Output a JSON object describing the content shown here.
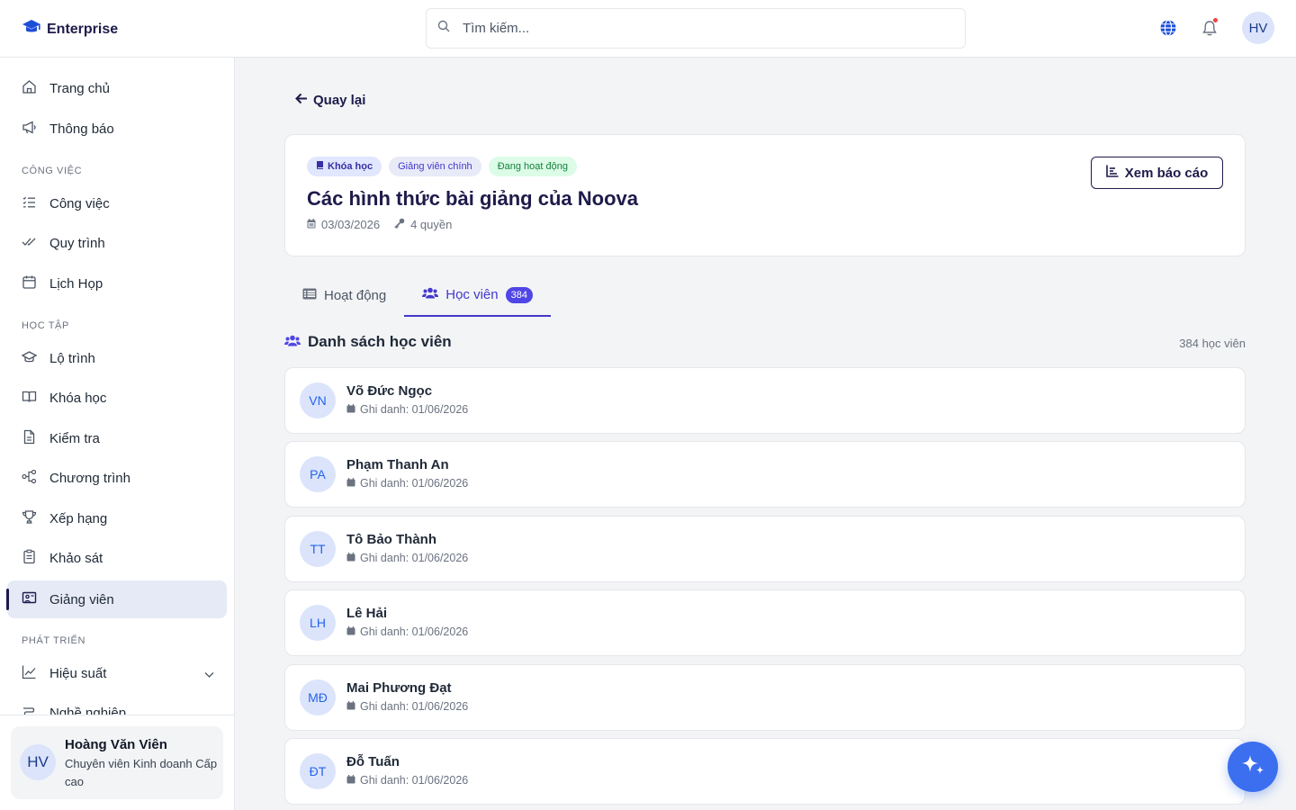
{
  "brand": {
    "name": "Enterprise"
  },
  "search": {
    "placeholder": "Tìm kiếm..."
  },
  "header": {
    "avatar_initials": "HV"
  },
  "sidebar": {
    "items_top": [
      {
        "label": "Trang chủ",
        "icon": "home-icon"
      },
      {
        "label": "Thông báo",
        "icon": "megaphone-icon"
      }
    ],
    "sections": [
      {
        "label": "CÔNG VIỆC",
        "items": [
          {
            "label": "Công việc",
            "icon": "task-list-icon"
          },
          {
            "label": "Quy trình",
            "icon": "double-check-icon"
          },
          {
            "label": "Lịch Họp",
            "icon": "calendar-icon"
          }
        ]
      },
      {
        "label": "HỌC TẬP",
        "items": [
          {
            "label": "Lộ trình",
            "icon": "graduation-cap-icon"
          },
          {
            "label": "Khóa học",
            "icon": "book-open-icon"
          },
          {
            "label": "Kiểm tra",
            "icon": "document-icon"
          },
          {
            "label": "Chương trình",
            "icon": "workflow-icon"
          },
          {
            "label": "Xếp hạng",
            "icon": "trophy-icon"
          },
          {
            "label": "Khảo sát",
            "icon": "clipboard-icon"
          },
          {
            "label": "Giảng viên",
            "icon": "presentation-icon",
            "active": true
          }
        ]
      },
      {
        "label": "PHÁT TRIỂN",
        "items": [
          {
            "label": "Hiệu suất",
            "icon": "line-chart-icon"
          },
          {
            "label": "Nghề nghiệp",
            "icon": "career-icon"
          }
        ]
      }
    ],
    "user": {
      "initials": "HV",
      "name": "Hoàng Văn Viên",
      "role": "Chuyên viên Kinh doanh Cấp cao"
    }
  },
  "main": {
    "back_label": "Quay lại",
    "course": {
      "tags": [
        "Khóa học",
        "Giảng viên chính",
        "Đang hoạt động"
      ],
      "title": "Các hình thức bài giảng của Noova",
      "date": "03/03/2026",
      "permissions": "4 quyền",
      "report_button": "Xem báo cáo"
    },
    "tabs": [
      {
        "label": "Hoạt động",
        "icon": "list-icon"
      },
      {
        "label": "Học viên",
        "icon": "users-icon",
        "count": "384",
        "active": true
      }
    ],
    "list": {
      "title": "Danh sách học viên",
      "count_text": "384 học viên",
      "students": [
        {
          "initials": "VN",
          "name": "Võ Đức Ngọc",
          "enrolled": "Ghi danh: 01/06/2026"
        },
        {
          "initials": "PA",
          "name": "Phạm Thanh An",
          "enrolled": "Ghi danh: 01/06/2026"
        },
        {
          "initials": "TT",
          "name": "Tô Bảo Thành",
          "enrolled": "Ghi danh: 01/06/2026"
        },
        {
          "initials": "LH",
          "name": "Lê Hải",
          "enrolled": "Ghi danh: 01/06/2026"
        },
        {
          "initials": "MĐ",
          "name": "Mai Phương Đạt",
          "enrolled": "Ghi danh: 01/06/2026"
        },
        {
          "initials": "ĐT",
          "name": "Đỗ Tuấn",
          "enrolled": "Ghi danh: 01/06/2026"
        }
      ]
    }
  },
  "colors": {
    "accent": "#4338ca",
    "brand_dark": "#1e1b4b",
    "fab": "#3b6ff0"
  }
}
